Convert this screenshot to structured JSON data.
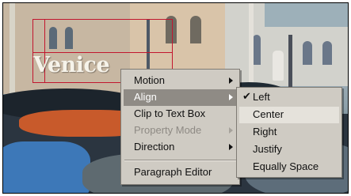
{
  "overlay_text": "Venice",
  "context_menu": {
    "items": [
      {
        "label": "Motion",
        "submenu": true,
        "enabled": true
      },
      {
        "label": "Align",
        "submenu": true,
        "enabled": true,
        "highlighted": true
      },
      {
        "label": "Clip to Text Box",
        "submenu": false,
        "enabled": true
      },
      {
        "label": "Property Mode",
        "submenu": true,
        "enabled": false
      },
      {
        "label": "Direction",
        "submenu": true,
        "enabled": true
      },
      {
        "label": "Paragraph Editor",
        "submenu": false,
        "enabled": true
      }
    ]
  },
  "align_submenu": {
    "items": [
      {
        "label": "Left",
        "checked": true
      },
      {
        "label": "Center",
        "hovered": true
      },
      {
        "label": "Right"
      },
      {
        "label": "Justify"
      },
      {
        "label": "Equally Space"
      }
    ],
    "check_glyph": "✔"
  },
  "colors": {
    "menu_bg": "#cfcbc3",
    "menu_highlight": "#8f8b85",
    "selection_box": "#c2162e"
  },
  "icons": {
    "submenu_arrow": "triangle-right",
    "check": "check-icon"
  }
}
